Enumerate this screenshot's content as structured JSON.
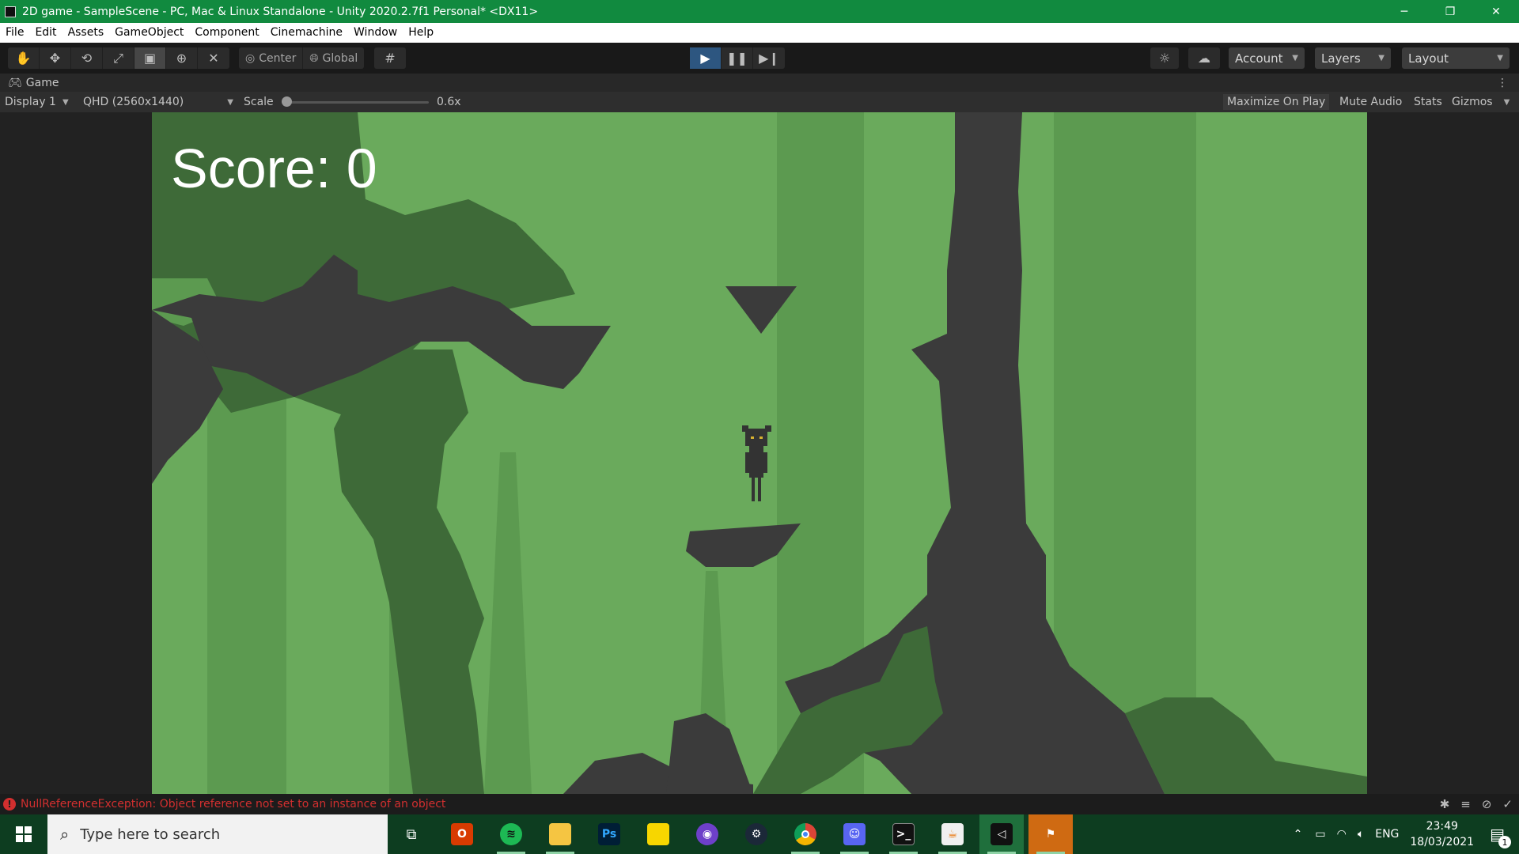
{
  "titlebar": {
    "title": "2D game - SampleScene - PC, Mac & Linux Standalone - Unity 2020.2.7f1 Personal* <DX11>",
    "minimize": "─",
    "restore": "❐",
    "close": "✕"
  },
  "menu": {
    "items": [
      "File",
      "Edit",
      "Assets",
      "GameObject",
      "Component",
      "Cinemachine",
      "Window",
      "Help"
    ]
  },
  "toolbar": {
    "pivot_label": "Center",
    "space_label": "Global",
    "account_label": "Account",
    "layers_label": "Layers",
    "layout_label": "Layout"
  },
  "gametab": {
    "label": "Game"
  },
  "gamebar": {
    "display": "Display 1",
    "resolution": "QHD (2560x1440)",
    "scale_label": "Scale",
    "scale_value": "0.6x",
    "maximize_on_play": "Maximize On Play",
    "mute_audio": "Mute Audio",
    "stats": "Stats",
    "gizmos": "Gizmos"
  },
  "game": {
    "score_text": "Score: 0",
    "colors": {
      "bg_light": "#6fae5f",
      "bg_mid": "#5e9a52",
      "foliage_dark": "#3d6638",
      "rock": "#3b3b3b"
    }
  },
  "statusbar": {
    "error_message": "NullReferenceException: Object reference not set to an instance of an object"
  },
  "taskbar": {
    "search_placeholder": "Type here to search",
    "language": "ENG",
    "time": "23:49",
    "date": "18/03/2021",
    "notification_count": "1"
  }
}
